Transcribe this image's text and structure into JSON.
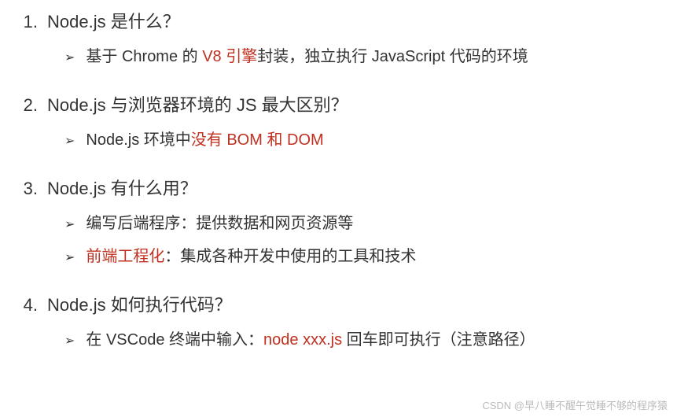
{
  "items": [
    {
      "num": "1.",
      "title": "Node.js 是什么？",
      "subs": [
        {
          "parts": [
            {
              "t": "基于 Chrome 的 ",
              "red": false
            },
            {
              "t": "V8 引擎",
              "red": true
            },
            {
              "t": "封装，独立执行 JavaScript 代码的环境",
              "red": false
            }
          ]
        }
      ]
    },
    {
      "num": "2.",
      "title": "Node.js 与浏览器环境的 JS 最大区别？",
      "subs": [
        {
          "parts": [
            {
              "t": "Node.js 环境中",
              "red": false
            },
            {
              "t": "没有 BOM 和 DOM",
              "red": true
            }
          ]
        }
      ]
    },
    {
      "num": "3.",
      "title": "Node.js 有什么用？",
      "subs": [
        {
          "parts": [
            {
              "t": "编写后端程序：提供数据和网页资源等",
              "red": false
            }
          ]
        },
        {
          "parts": [
            {
              "t": "前端工程化",
              "red": true
            },
            {
              "t": "：集成各种开发中使用的工具和技术",
              "red": false
            }
          ]
        }
      ]
    },
    {
      "num": "4.",
      "title": "Node.js 如何执行代码？",
      "subs": [
        {
          "parts": [
            {
              "t": "在 VSCode 终端中输入：",
              "red": false
            },
            {
              "t": "node xxx.js",
              "red": true
            },
            {
              "t": " 回车即可执行（注意路径）",
              "red": false
            }
          ]
        }
      ]
    }
  ],
  "arrow": "➢",
  "watermark": "CSDN @早八睡不醒午觉睡不够的程序猿"
}
